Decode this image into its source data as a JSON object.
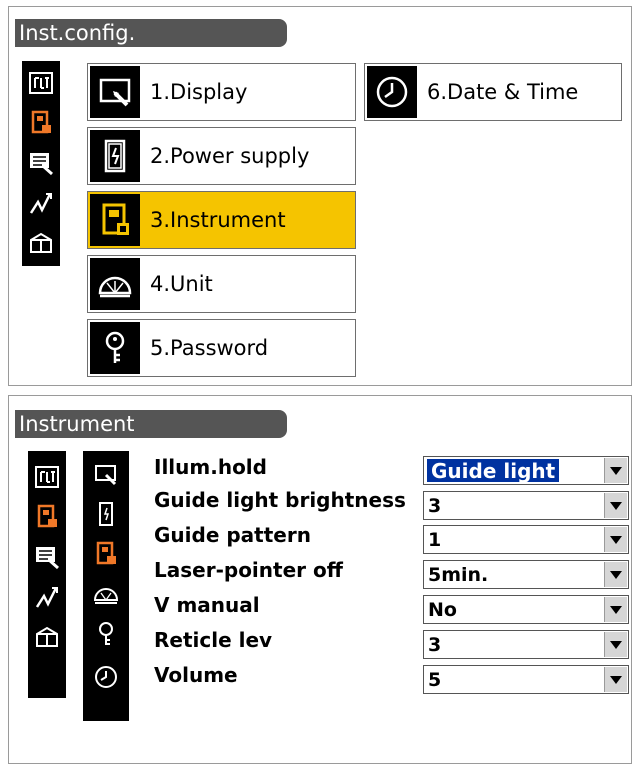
{
  "screen1": {
    "title": "Inst.config.",
    "sidebar_icons": [
      "config-icon",
      "instrument-icon",
      "data-icon",
      "graph-icon",
      "box-icon"
    ],
    "menu": [
      {
        "label": "1.Display",
        "icon": "display-icon",
        "selected": false
      },
      {
        "label": "2.Power supply",
        "icon": "battery-icon",
        "selected": false
      },
      {
        "label": "3.Instrument",
        "icon": "instrument-icon",
        "selected": true
      },
      {
        "label": "4.Unit",
        "icon": "protractor-icon",
        "selected": false
      },
      {
        "label": "5.Password",
        "icon": "key-icon",
        "selected": false
      },
      {
        "label": "6.Date & Time",
        "icon": "clock-icon",
        "selected": false
      }
    ]
  },
  "screen2": {
    "title": "Instrument",
    "sidebar_icons": [
      "config-icon",
      "instrument-icon",
      "data-icon",
      "graph-icon",
      "box-icon"
    ],
    "tab_icons": [
      "display-icon",
      "battery-icon",
      "instrument-icon",
      "protractor-icon",
      "key-icon",
      "clock-icon"
    ],
    "settings": [
      {
        "label": "Illum.hold",
        "value": "Guide light",
        "focused": true
      },
      {
        "label": "Guide light brightness",
        "value": "3",
        "focused": false
      },
      {
        "label": "Guide pattern",
        "value": "1",
        "focused": false
      },
      {
        "label": "Laser-pointer off",
        "value": "5min.",
        "focused": false
      },
      {
        "label": "V manual",
        "value": "No",
        "focused": false
      },
      {
        "label": "Reticle lev",
        "value": "3",
        "focused": false
      },
      {
        "label": "Volume",
        "value": "5",
        "focused": false
      }
    ]
  },
  "colors": {
    "selected": "#f5c400",
    "focus": "#0032a0",
    "titlebar": "#555555",
    "instrument_orange": "#f07828"
  }
}
